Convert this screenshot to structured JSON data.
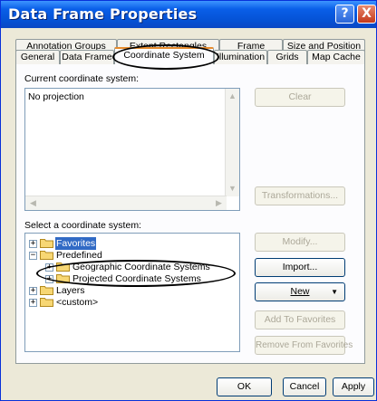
{
  "window": {
    "title": "Data Frame Properties"
  },
  "titlebar_buttons": {
    "help": "?",
    "close": "X"
  },
  "tabs": {
    "back_row": [
      "Annotation Groups",
      "Extent Rectangles",
      "Frame",
      "Size and Position"
    ],
    "front_row": [
      "General",
      "Data Frame",
      "Coordinate System",
      "Illumination",
      "Grids",
      "Map Cache"
    ],
    "active": "Coordinate System"
  },
  "current_cs": {
    "label": "Current coordinate system:",
    "value": "No projection",
    "clear_button": "Clear",
    "transformations_button": "Transformations..."
  },
  "select_cs": {
    "label": "Select a coordinate system:",
    "tree": [
      {
        "label": "Favorites",
        "expander": "+",
        "selected": true
      },
      {
        "label": "Predefined",
        "expander": "−"
      },
      {
        "label": "Geographic Coordinate Systems",
        "expander": "+"
      },
      {
        "label": "Projected Coordinate Systems",
        "expander": "+"
      },
      {
        "label": "Layers",
        "expander": "+"
      },
      {
        "label": "<custom>",
        "expander": "+"
      }
    ],
    "buttons": {
      "modify": "Modify...",
      "import": "Import...",
      "new": "New",
      "add_favorites": "Add To Favorites",
      "remove_favorites": "Remove From Favorites"
    }
  },
  "footer": {
    "ok": "OK",
    "cancel": "Cancel",
    "apply": "Apply"
  },
  "colors": {
    "title_bar": "#0553d6",
    "selection": "#316ac5",
    "active_tab_accent": "#e68b2c",
    "dialog_face": "#ece9d8"
  }
}
